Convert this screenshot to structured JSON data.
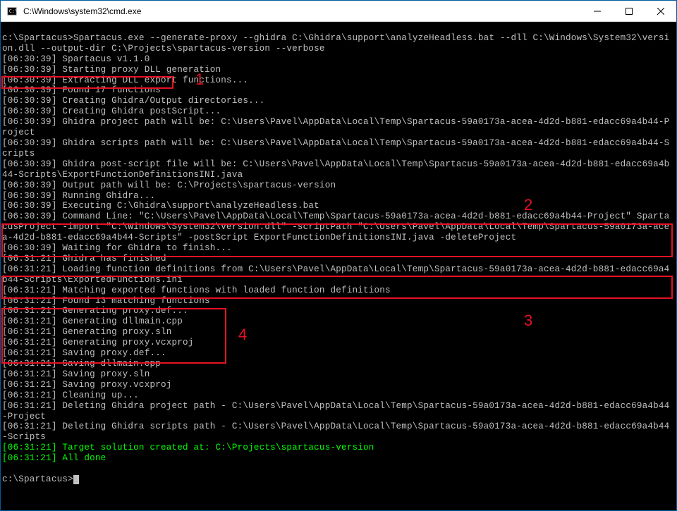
{
  "window": {
    "title": "C:\\Windows\\system32\\cmd.exe"
  },
  "terminal": {
    "prompt": "c:\\Spartacus>",
    "command": "Spartacus.exe --generate-proxy --ghidra C:\\Ghidra\\support\\analyzeHeadless.bat --dll C:\\Windows\\System32\\version.dll --output-dir C:\\Projects\\spartacus-version --verbose",
    "lines": [
      "[06:30:39] Spartacus v1.1.0",
      "[06:30:39] Starting proxy DLL generation",
      "[06:30:39] Extracting DLL export functions...",
      "[06:30:39] Found 17 functions",
      "[06:30:39] Creating Ghidra/Output directories...",
      "[06:30:39] Creating Ghidra postScript...",
      "[06:30:39] Ghidra project path will be: C:\\Users\\Pavel\\AppData\\Local\\Temp\\Spartacus-59a0173a-acea-4d2d-b881-edacc69a4b44-Project",
      "[06:30:39] Ghidra scripts path will be: C:\\Users\\Pavel\\AppData\\Local\\Temp\\Spartacus-59a0173a-acea-4d2d-b881-edacc69a4b44-Scripts",
      "[06:30:39] Ghidra post-script file will be: C:\\Users\\Pavel\\AppData\\Local\\Temp\\Spartacus-59a0173a-acea-4d2d-b881-edacc69a4b44-Scripts\\ExportFunctionDefinitionsINI.java",
      "[06:30:39] Output path will be: C:\\Projects\\spartacus-version",
      "[06:30:39] Running Ghidra...",
      "[06:30:39] Executing C:\\Ghidra\\support\\analyzeHeadless.bat",
      "[06:30:39] Command Line: \"C:\\Users\\Pavel\\AppData\\Local\\Temp\\Spartacus-59a0173a-acea-4d2d-b881-edacc69a4b44-Project\" SpartacusProject -import \"C:\\Windows\\System32\\version.dll\" -scriptPath \"C:\\Users\\Pavel\\AppData\\Local\\Temp\\Spartacus-59a0173a-acea-4d2d-b881-edacc69a4b44-Scripts\" -postScript ExportFunctionDefinitionsINI.java -deleteProject",
      "[06:30:39] Waiting for Ghidra to finish...",
      "[06:31:21] Ghidra has finished",
      "[06:31:21] Loading function definitions from C:\\Users\\Pavel\\AppData\\Local\\Temp\\Spartacus-59a0173a-acea-4d2d-b881-edacc69a4b44-Scripts\\ExportedFunctions.ini",
      "[06:31:21] Matching exported functions with loaded function definitions",
      "[06:31:21] Found 13 matching functions",
      "[06:31:21] Generating proxy.def...",
      "[06:31:21] Generating dllmain.cpp",
      "[06:31:21] Generating proxy.sln",
      "[06:31:21] Generating proxy.vcxproj",
      "[06:31:21] Saving proxy.def...",
      "[06:31:21] Saving dllmain.cpp",
      "[06:31:21] Saving proxy.sln",
      "[06:31:21] Saving proxy.vcxproj",
      "[06:31:21] Cleaning up...",
      "[06:31:21] Deleting Ghidra project path - C:\\Users\\Pavel\\AppData\\Local\\Temp\\Spartacus-59a0173a-acea-4d2d-b881-edacc69a4b44-Project",
      "[06:31:21] Deleting Ghidra scripts path - C:\\Users\\Pavel\\AppData\\Local\\Temp\\Spartacus-59a0173a-acea-4d2d-b881-edacc69a4b44-Scripts"
    ],
    "success_lines": [
      "[06:31:21] Target solution created at: C:\\Projects\\spartacus-version",
      "[06:31:21] All done"
    ],
    "end_prompt": "c:\\Spartacus>"
  },
  "annotations": {
    "n1": "1",
    "n2": "2",
    "n3": "3",
    "n4": "4"
  }
}
